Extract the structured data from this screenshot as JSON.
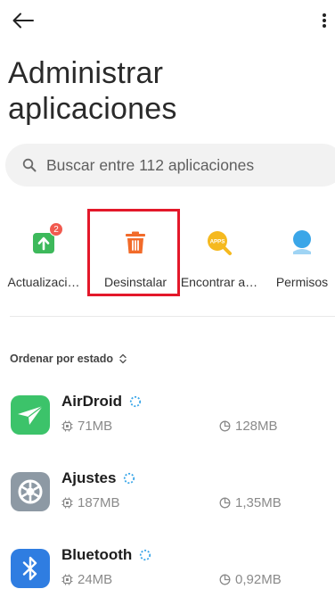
{
  "colors": {
    "accent_highlight": "#e3182a",
    "update_green": "#3db95b",
    "uninstall_orange": "#f26b2a",
    "find_yellow": "#f5b91f",
    "permissions_blue": "#3aa6e8",
    "airdroid_green": "#3cc36a",
    "ajustes_gray": "#8d99a4",
    "bluetooth_blue": "#2f7de1"
  },
  "header": {
    "back_icon": "arrow-left-icon",
    "more_icon": "more-vertical-icon",
    "title": "Administrar aplicaciones"
  },
  "search": {
    "placeholder": "Buscar entre 112 aplicaciones",
    "icon": "search-icon"
  },
  "actions": [
    {
      "label": "Actualizaci…",
      "icon": "update-icon",
      "badge": "2"
    },
    {
      "label": "Desinstalar",
      "icon": "trash-icon"
    },
    {
      "label": "Encontrar a…",
      "icon": "find-apps-icon",
      "icon_text": "APPS"
    },
    {
      "label": "Permisos",
      "icon": "permissions-icon"
    }
  ],
  "sort": {
    "label": "Ordenar por estado",
    "icon": "sort-arrows-icon"
  },
  "apps": [
    {
      "name": "AirDroid",
      "size": "71MB",
      "cache": "128MB",
      "icon": "airdroid-icon"
    },
    {
      "name": "Ajustes",
      "size": "187MB",
      "cache": "1,35MB",
      "icon": "settings-gear-icon"
    },
    {
      "name": "Bluetooth",
      "size": "24MB",
      "cache": "0,92MB",
      "icon": "bluetooth-icon"
    }
  ]
}
